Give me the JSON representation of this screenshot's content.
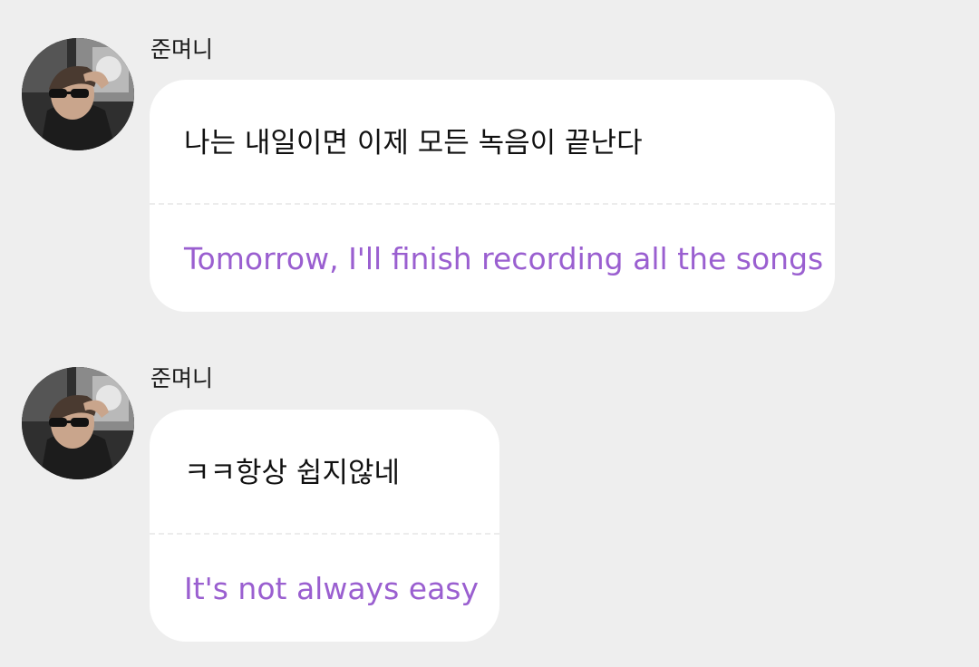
{
  "conversation": {
    "messages": [
      {
        "sender": "준며니",
        "original": "나는 내일이면 이제 모든 녹음이 끝난다",
        "translation": "Tomorrow, I'll finish recording all the songs"
      },
      {
        "sender": "준며니",
        "original": "ㅋㅋ항상 쉽지않네",
        "translation": "It's not always easy"
      }
    ]
  },
  "colors": {
    "background": "#eeeeee",
    "bubble": "#ffffff",
    "original_text": "#111111",
    "translation_text": "#9a5fd0",
    "sender_text": "#1a1a1a"
  },
  "icons": {
    "avatar": "profile-photo"
  }
}
